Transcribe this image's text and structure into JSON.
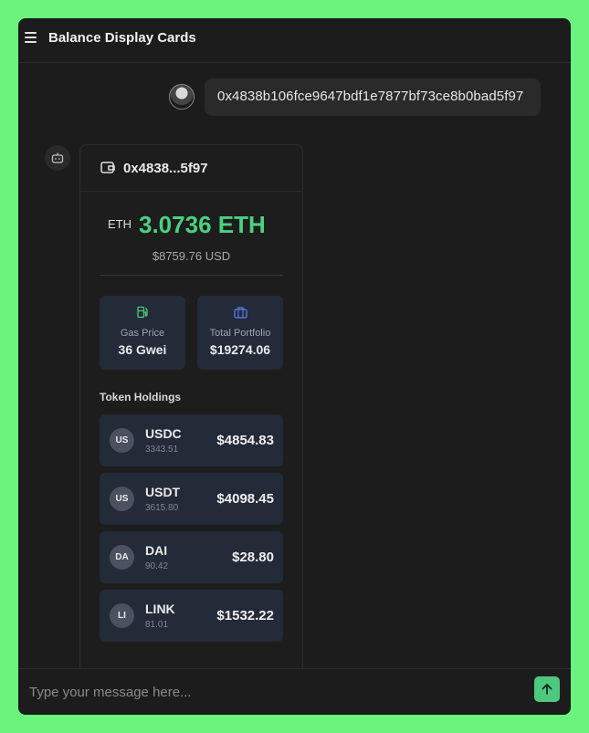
{
  "app": {
    "title": "Balance Display Cards"
  },
  "user_message": {
    "text": "0x4838b106fce9647bdf1e7877bf73ce8b0bad5f97"
  },
  "card": {
    "address_short": "0x4838...5f97",
    "eth_label": "ETH",
    "eth_balance": "3.0736 ETH",
    "usd_balance": "$8759.76 USD",
    "stats": [
      {
        "icon": "fuel-pump-icon",
        "label": "Gas Price",
        "value": "36 Gwei"
      },
      {
        "icon": "briefcase-icon",
        "label": "Total Portfolio",
        "value": "$19274.06"
      }
    ],
    "holdings_title": "Token Holdings",
    "tokens": [
      {
        "badge": "US",
        "symbol": "USDC",
        "amount": "3343.51",
        "value": "$4854.83"
      },
      {
        "badge": "US",
        "symbol": "USDT",
        "amount": "3615.80",
        "value": "$4098.45"
      },
      {
        "badge": "DA",
        "symbol": "DAI",
        "amount": "90.42",
        "value": "$28.80"
      },
      {
        "badge": "LI",
        "symbol": "LINK",
        "amount": "81.01",
        "value": "$1532.22"
      }
    ]
  },
  "composer": {
    "placeholder": "Type your message here..."
  },
  "colors": {
    "page_background": "#6af47e",
    "app_background": "#1c1c1c",
    "accent_green": "#4ad180",
    "tile_background": "#232a38",
    "gas_icon": "#4cc97e",
    "portfolio_icon": "#5b7cf0"
  }
}
